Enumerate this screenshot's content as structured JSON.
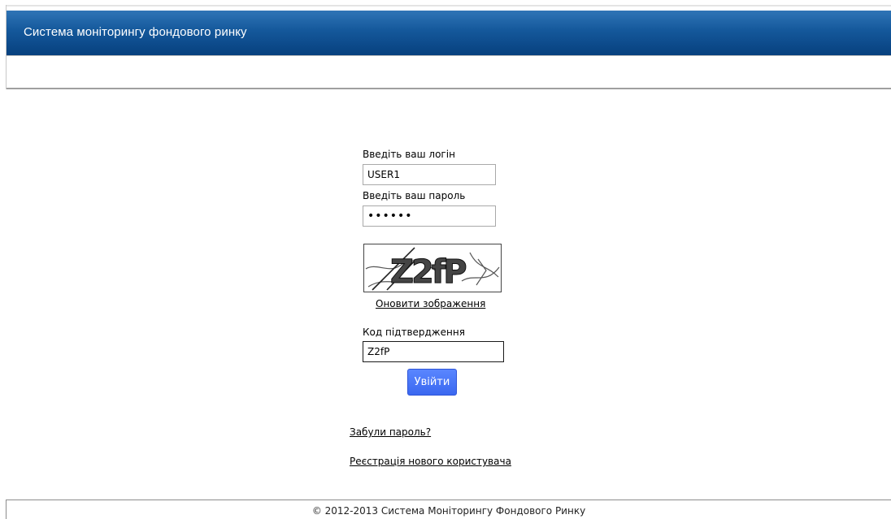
{
  "header": {
    "title": "Система моніторингу фондового ринку"
  },
  "login": {
    "login_label": "Введіть ваш логін",
    "login_value": "USER1",
    "password_label": "Введіть ваш пароль",
    "password_value": "••••••",
    "captcha_text": "Z2fP",
    "refresh_image_link": "Оновити зображення",
    "code_label": "Код підтвердження",
    "code_value": "Z2fP",
    "submit_label": "Увійти",
    "forgot_password_link": "Забули пароль?",
    "register_link": "Реєстрація нового користувача"
  },
  "footer": {
    "copyright": "© 2012-2013 Система Моніторингу Фондового Ринку"
  },
  "colors": {
    "header_gradient_top": "#2f74b6",
    "header_gradient_bottom": "#07407e",
    "button_blue": "#3b68f0"
  },
  "icons": [
    "captcha-image"
  ]
}
